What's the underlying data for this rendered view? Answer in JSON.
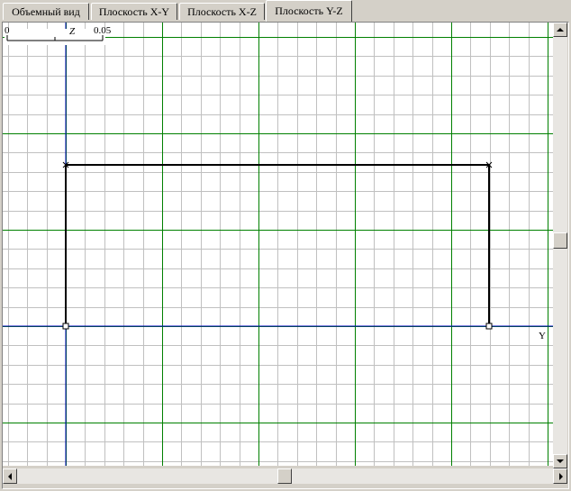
{
  "tabs": [
    {
      "label": "Объемный вид",
      "active": false
    },
    {
      "label": "Плоскость X-Y",
      "active": false
    },
    {
      "label": "Плоскость X-Z",
      "active": false
    },
    {
      "label": "Плоскость Y-Z",
      "active": true
    }
  ],
  "scale_bar": {
    "start_label": "0",
    "end_label": "0.05"
  },
  "axes": {
    "vertical_label": "Z",
    "horizontal_label": "Y"
  },
  "colors": {
    "minor_grid": "#c0c0c0",
    "major_grid": "#008000",
    "axis_line": "#0000c0",
    "shape_stroke": "#000000",
    "background": "#ffffff"
  }
}
